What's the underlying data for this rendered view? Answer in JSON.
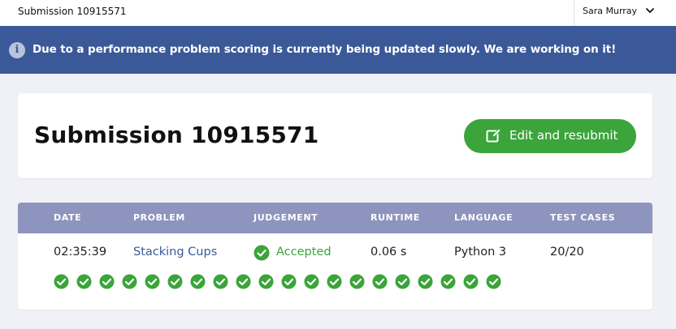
{
  "topbar": {
    "breadcrumb": "Submission 10915571",
    "user_name": "Sara Murray"
  },
  "banner": {
    "message": "Due to a performance problem scoring is currently being updated slowly. We are working on it!"
  },
  "header": {
    "title": "Submission 10915571",
    "edit_button": "Edit and resubmit"
  },
  "table": {
    "headers": {
      "date": "DATE",
      "problem": "PROBLEM",
      "judgement": "JUDGEMENT",
      "runtime": "RUNTIME",
      "language": "LANGUAGE",
      "test_cases": "TEST CASES"
    },
    "row": {
      "date": "02:35:39",
      "problem": "Stacking Cups",
      "judgement": "Accepted",
      "runtime": "0.06 s",
      "language": "Python 3",
      "test_cases": "20/20"
    },
    "test_case_passed_count": 20
  },
  "colors": {
    "banner": "#3b5998",
    "accent_green": "#3ba43b",
    "table_header": "#8d94bd"
  }
}
